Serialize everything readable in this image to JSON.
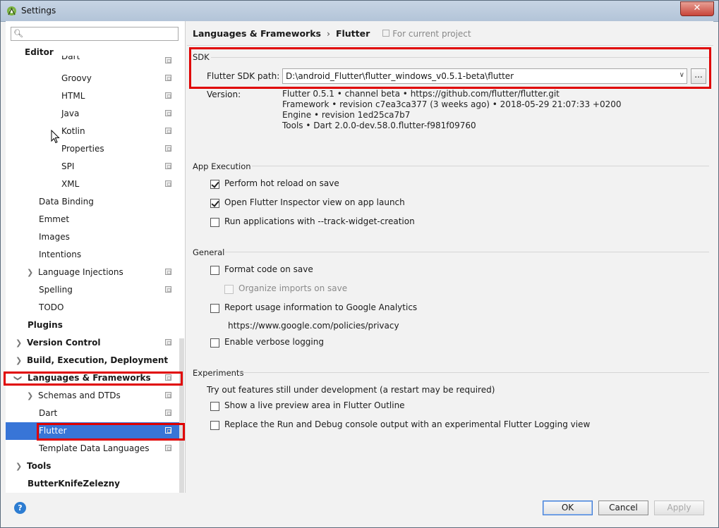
{
  "window": {
    "title": "Settings",
    "close_label": "✕"
  },
  "search": {
    "value": "",
    "placeholder": ""
  },
  "sidebar": {
    "items": [
      {
        "label": "Editor"
      },
      {
        "label": "Dart"
      },
      {
        "label": "Groovy"
      },
      {
        "label": "HTML"
      },
      {
        "label": "Java"
      },
      {
        "label": "Kotlin"
      },
      {
        "label": "Properties"
      },
      {
        "label": "SPI"
      },
      {
        "label": "XML"
      },
      {
        "label": "Data Binding"
      },
      {
        "label": "Emmet"
      },
      {
        "label": "Images"
      },
      {
        "label": "Intentions"
      },
      {
        "label": "Language Injections"
      },
      {
        "label": "Spelling"
      },
      {
        "label": "TODO"
      },
      {
        "label": "Plugins"
      },
      {
        "label": "Version Control"
      },
      {
        "label": "Build, Execution, Deployment"
      },
      {
        "label": "Languages & Frameworks"
      },
      {
        "label": "Schemas and DTDs"
      },
      {
        "label": "Dart"
      },
      {
        "label": "Flutter"
      },
      {
        "label": "Template Data Languages"
      },
      {
        "label": "Tools"
      },
      {
        "label": "ButterKnifeZelezny"
      }
    ]
  },
  "breadcrumb": {
    "parent": "Languages & Frameworks",
    "separator": "›",
    "current": "Flutter",
    "scope": "For current project"
  },
  "sdk": {
    "section": "SDK",
    "path_label": "Flutter SDK path:",
    "path_value": "D:\\android_Flutter\\flutter_windows_v0.5.1-beta\\flutter",
    "browse_label": "...",
    "version_label": "Version:",
    "version_lines": [
      "Flutter 0.5.1 • channel beta • https://github.com/flutter/flutter.git",
      "Framework • revision c7ea3ca377 (3 weeks ago) • 2018-05-29 21:07:33 +0200",
      "Engine • revision 1ed25ca7b7",
      "Tools • Dart 2.0.0-dev.58.0.flutter-f981f09760"
    ]
  },
  "app_execution": {
    "section": "App Execution",
    "options": [
      {
        "label": "Perform hot reload on save",
        "checked": true
      },
      {
        "label": "Open Flutter Inspector view on app launch",
        "checked": true
      },
      {
        "label": "Run applications with --track-widget-creation",
        "checked": false
      }
    ]
  },
  "general": {
    "section": "General",
    "format_on_save": "Format code on save",
    "organize_imports": "Organize imports on save",
    "report_usage": "Report usage information to Google Analytics",
    "privacy_link": "https://www.google.com/policies/privacy",
    "verbose_logging": "Enable verbose logging"
  },
  "experiments": {
    "section": "Experiments",
    "description": "Try out features still under development (a restart may be required)",
    "live_preview": "Show a live preview area in Flutter Outline",
    "logging_view": "Replace the Run and Debug console output with an experimental Flutter Logging view"
  },
  "buttons": {
    "help": "?",
    "ok": "OK",
    "cancel": "Cancel",
    "apply": "Apply"
  },
  "colors": {
    "selection": "#3875d7",
    "highlight_box": "#e00000"
  }
}
